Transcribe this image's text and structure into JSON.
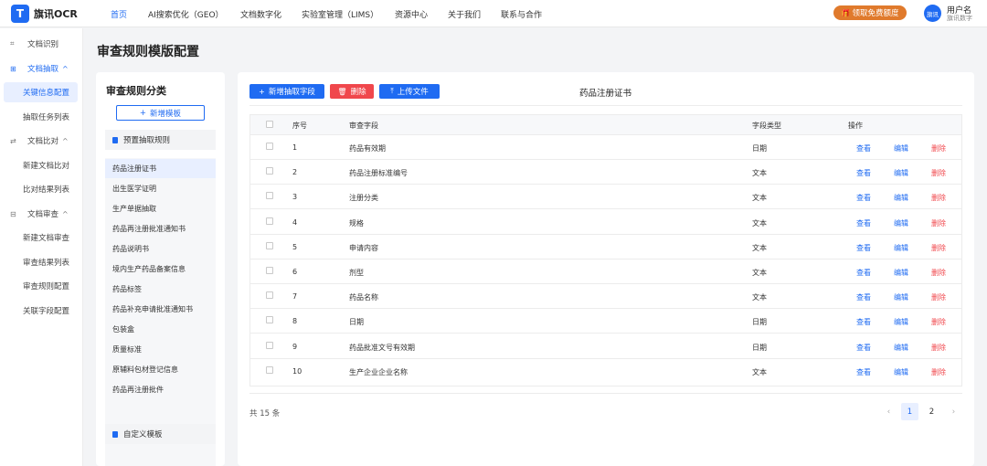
{
  "app": {
    "logo_letter": "T",
    "name": "旗讯OCR"
  },
  "nav": [
    "首页",
    "AI搜索优化（GEO）",
    "文档数字化",
    "实验室管理（LIMS）",
    "资源中心",
    "关于我们",
    "联系与合作"
  ],
  "promo": {
    "label": "领取免费额度",
    "icon": "gift-icon"
  },
  "user": {
    "avatar_text": "旗讯",
    "name": "用户名",
    "org": "旗讯数字"
  },
  "sidebar": {
    "items": [
      {
        "label": "文档识别",
        "icon": "scan-icon"
      },
      {
        "label": "文档抽取",
        "icon": "grid-icon"
      },
      {
        "label": "关键信息配置"
      },
      {
        "label": "抽取任务列表"
      },
      {
        "label": "文档比对",
        "icon": "compare-icon"
      },
      {
        "label": "新建文档比对"
      },
      {
        "label": "比对结果列表"
      },
      {
        "label": "文档审查",
        "icon": "review-icon"
      },
      {
        "label": "新建文档审查"
      },
      {
        "label": "审查结果列表"
      },
      {
        "label": "审查规则配置"
      },
      {
        "label": "关联字段配置"
      }
    ]
  },
  "page": {
    "title": "审查规则模版配置"
  },
  "categories": {
    "title": "审查规则分类",
    "add_label": "新增模板",
    "preset_label": "预置抽取规则",
    "custom_label": "自定义模板",
    "items": [
      "药品注册证书",
      "出生医学证明",
      "生产单据抽取",
      "药品再注册批准通知书",
      "药品说明书",
      "境内生产药品备案信息",
      "药品标签",
      "药品补充申请批准通知书",
      "包装盒",
      "质量标准",
      "原辅料包材登记信息",
      "药品再注册批件"
    ],
    "selected_index": 0
  },
  "toolbar": {
    "add_field": "新增抽取字段",
    "delete": "删除",
    "upload": "上传文件"
  },
  "doc_title": "药品注册证书",
  "table": {
    "headers": {
      "index": "序号",
      "field": "审查字段",
      "type": "字段类型",
      "action": "操作"
    },
    "rows": [
      {
        "index": "1",
        "field": "药品有效期",
        "type": "日期"
      },
      {
        "index": "2",
        "field": "药品注册标准编号",
        "type": "文本"
      },
      {
        "index": "3",
        "field": "注册分类",
        "type": "文本"
      },
      {
        "index": "4",
        "field": "规格",
        "type": "文本"
      },
      {
        "index": "5",
        "field": "申请内容",
        "type": "文本"
      },
      {
        "index": "6",
        "field": "剂型",
        "type": "文本"
      },
      {
        "index": "7",
        "field": "药品名称",
        "type": "文本"
      },
      {
        "index": "8",
        "field": "日期",
        "type": "日期"
      },
      {
        "index": "9",
        "field": "药品批准文号有效期",
        "type": "日期"
      },
      {
        "index": "10",
        "field": "生产企业企业名称",
        "type": "文本"
      }
    ],
    "actions": {
      "view": "查看",
      "edit": "编辑",
      "delete": "删除"
    }
  },
  "pagination": {
    "total": "共 15 条",
    "prev": "‹",
    "pages": [
      "1",
      "2"
    ],
    "current": "1",
    "next": "›"
  }
}
